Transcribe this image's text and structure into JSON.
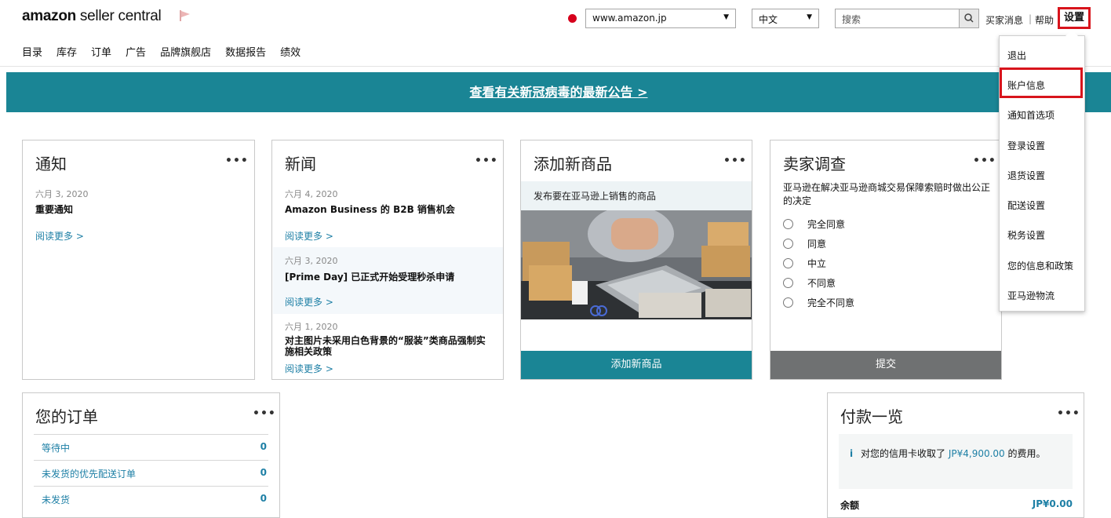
{
  "header": {
    "logo_bold": "amazon",
    "logo_light": " seller central",
    "marketplace": "www.amazon.jp",
    "language": "中文",
    "search_placeholder": "搜索",
    "links": [
      "买家消息",
      "帮助"
    ],
    "settings_label": "设置"
  },
  "nav": {
    "items": [
      "目录",
      "库存",
      "订单",
      "广告",
      "品牌旗舰店",
      "数据报告",
      "绩效"
    ]
  },
  "banner": {
    "text": "查看有关新冠病毒的最新公告 >"
  },
  "notice_card": {
    "title": "通知",
    "more": "•••",
    "date": "六月 3, 2020",
    "headline": "重要通知",
    "readmore": "阅读更多 >"
  },
  "news_card": {
    "title": "新闻",
    "more": "•••",
    "items": [
      {
        "date": "六月 4, 2020",
        "headline": "Amazon Business 的 B2B 销售机会",
        "readmore": "阅读更多 >"
      },
      {
        "date": "六月 3, 2020",
        "headline": "[Prime Day] 已正式开始受理秒杀申请",
        "readmore": "阅读更多 >"
      },
      {
        "date": "六月 1, 2020",
        "headline": "对主图片未采用白色背景的“服装”类商品强制实施相关政策",
        "readmore": "阅读更多 >"
      }
    ]
  },
  "add_product_card": {
    "title": "添加新商品",
    "more": "•••",
    "subtitle": "发布要在亚马逊上销售的商品",
    "button": "添加新商品",
    "accent": "#1a8595"
  },
  "survey_card": {
    "title": "卖家调查",
    "more": "•••",
    "question": "亚马逊在解决亚马逊商城交易保障索赔时做出公正的决定",
    "options": [
      "完全同意",
      "同意",
      "中立",
      "不同意",
      "完全不同意"
    ],
    "submit": "提交"
  },
  "orders_card": {
    "title": "您的订单",
    "more": "•••",
    "rows": [
      {
        "label": "等待中",
        "count": "0"
      },
      {
        "label": "未发货的优先配送订单",
        "count": "0"
      },
      {
        "label": "未发货",
        "count": "0"
      }
    ]
  },
  "payments_card": {
    "title": "付款一览",
    "more": "•••",
    "info_prefix": "对您的信用卡收取了 ",
    "info_amount": "JP¥4,900.00",
    "info_suffix": " 的费用。",
    "balance_label": "余额",
    "balance_value": "JP¥0.00"
  },
  "settings_menu": {
    "items": [
      "退出",
      "账户信息",
      "通知首选项",
      "登录设置",
      "退货设置",
      "配送设置",
      "税务设置",
      "您的信息和政策",
      "亚马逊物流"
    ]
  },
  "colors": {
    "teal": "#1a8595",
    "link": "#1d7fa5",
    "highlight_red": "#d8141c"
  }
}
